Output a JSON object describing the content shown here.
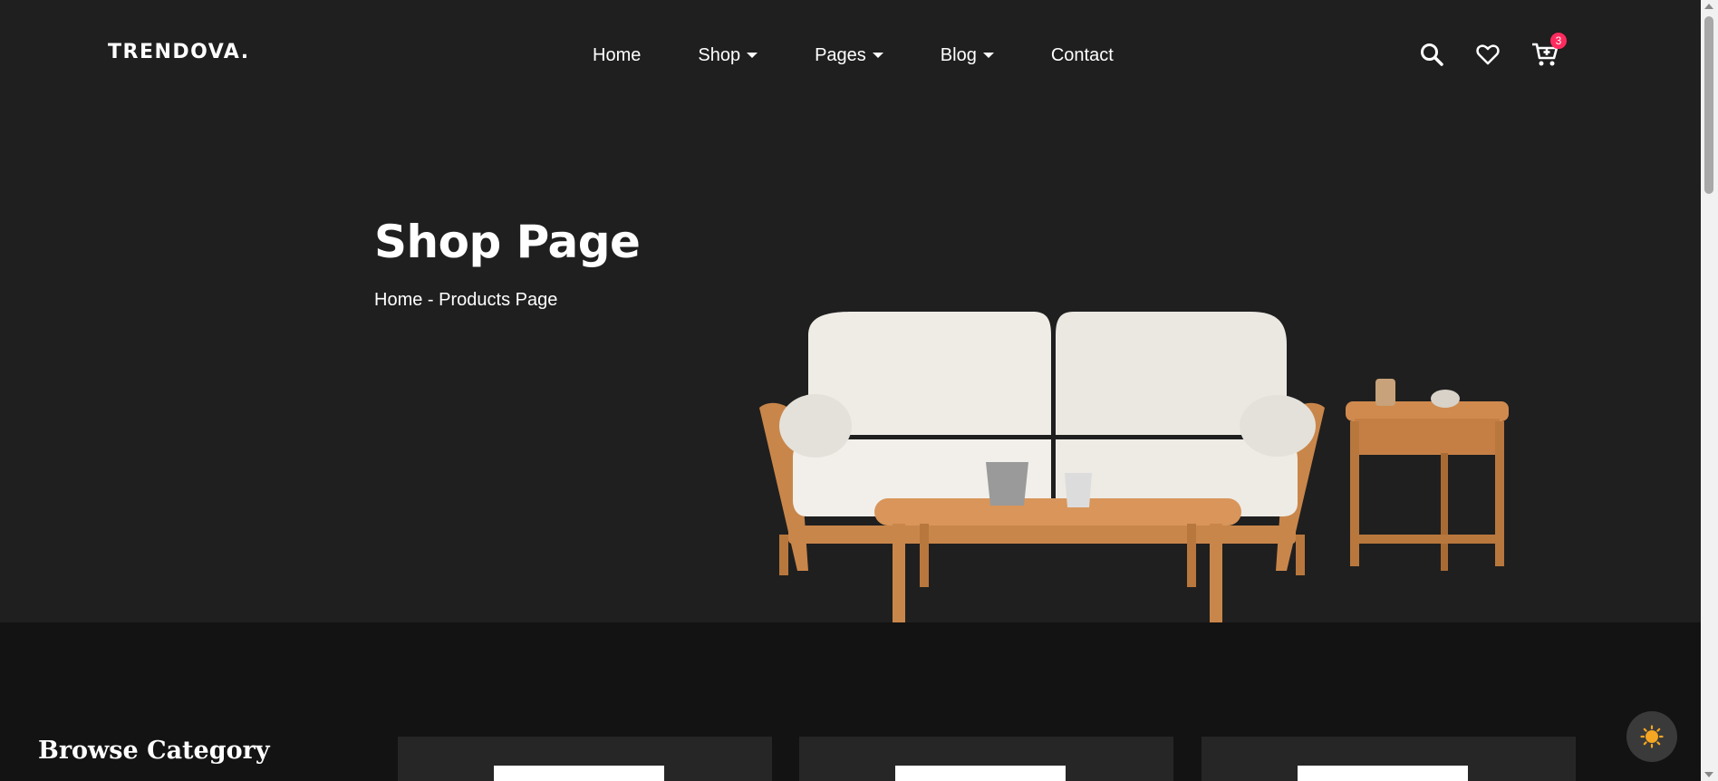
{
  "header": {
    "logo": "TRENDOVA.",
    "nav": [
      {
        "label": "Home",
        "dropdown": false
      },
      {
        "label": "Shop",
        "dropdown": true
      },
      {
        "label": "Pages",
        "dropdown": true
      },
      {
        "label": "Blog",
        "dropdown": true
      },
      {
        "label": "Contact",
        "dropdown": false
      }
    ],
    "icons": [
      "search-icon",
      "heart-icon",
      "cart-icon"
    ],
    "cart_count": "3"
  },
  "hero": {
    "title": "Shop Page",
    "breadcrumb_home": "Home",
    "breadcrumb_sep": " - ",
    "breadcrumb_current": "Products Page"
  },
  "category": {
    "heading": "Browse Category"
  },
  "colors": {
    "background": "#1f1f1f",
    "section_dark": "#131313",
    "badge": "#ff2b5e",
    "wood": "#c9864a",
    "upholstery": "#efece6"
  }
}
